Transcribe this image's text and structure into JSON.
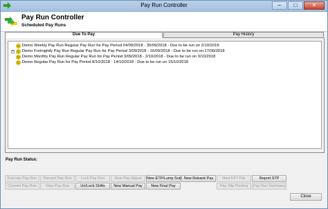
{
  "window": {
    "title": "Pay Run Controller"
  },
  "header": {
    "title": "Pay Run Controller",
    "subtitle": "Scheduled Pay Runs"
  },
  "tabs": [
    {
      "label": "Due To Pay",
      "active": true
    },
    {
      "label": "Pay History",
      "active": false
    }
  ],
  "pay_runs": [
    {
      "label": "Demo Weekly Pay Run Regular Pay Run for Pay Period 24/09/2018 - 30/09/2018 - Due to be run on 2/10/2018",
      "expandable": false
    },
    {
      "label": "Demo Fortnightly Pay Run Regular Pay Run for Pay Period 3/09/2018 - 16/09/2018 - Due to be run on 17/09/2018",
      "expandable": true
    },
    {
      "label": "Demo Monthly Pay Run Regular Pay Run for Pay Period 3/09/2018 - 2/10/2018 - Due to be run on 3/10/2018",
      "expandable": false
    },
    {
      "label": "Demo Regular Pay Run for Pay Period 8/10/2018 - 14/10/2018 - Due to be run on 15/10/2018",
      "expandable": false
    }
  ],
  "status": {
    "label": "Pay Run Status:"
  },
  "buttons_row1": [
    {
      "label": "Execute Pay Run",
      "enabled": false
    },
    {
      "label": "Discard Pay Run",
      "enabled": false
    },
    {
      "label": "Lock Pay Run",
      "enabled": false
    },
    {
      "label": "New Pay Adjust",
      "enabled": false
    },
    {
      "label": "New ETP/Lump Sum",
      "enabled": true
    },
    {
      "label": "New Rebank Pay",
      "enabled": true
    },
    {
      "label": "New EFT File",
      "enabled": false
    },
    {
      "label": "Report STP",
      "enabled": true
    }
  ],
  "buttons_row2": [
    {
      "label": "Commit Pay Run",
      "enabled": false
    },
    {
      "label": "View Pay Run",
      "enabled": false
    },
    {
      "label": "Un/Lock Shifts",
      "enabled": true
    },
    {
      "label": "New Manual Pay",
      "enabled": true
    },
    {
      "label": "New Final Pay",
      "enabled": true
    },
    {
      "label": "",
      "enabled": false
    },
    {
      "label": "Pay Slip Printing",
      "enabled": false
    },
    {
      "label": "Pay Run Summary",
      "enabled": false
    }
  ],
  "close_button": {
    "label": "Close"
  },
  "colors": {
    "accent_yellow": "#f5d000",
    "accent_green": "#2f9e2f",
    "title_bar": "#b9d1ea"
  },
  "icons": {
    "tree_node": "smiley-face-icon",
    "header": "green-arrows-icon",
    "app": "green-arrow-icon"
  }
}
